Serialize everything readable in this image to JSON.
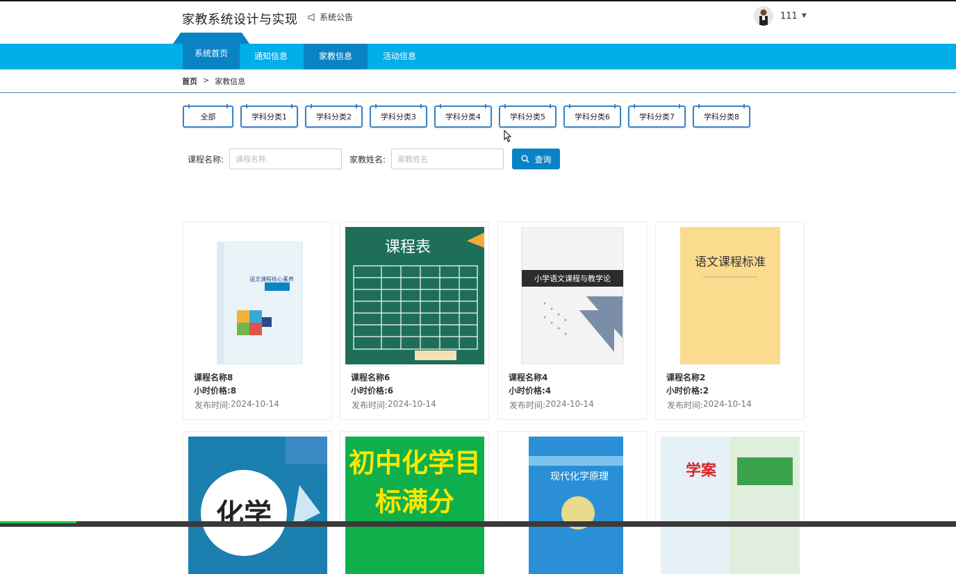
{
  "header": {
    "site_title": "家教系统设计与实现",
    "notice_label": "系统公告",
    "username": "111"
  },
  "nav": {
    "items": [
      "系统首页",
      "通知信息",
      "家教信息",
      "活动信息"
    ],
    "active": "家教信息"
  },
  "breadcrumb": {
    "home": "首页",
    "separator": ">",
    "current": "家教信息"
  },
  "categories": [
    "全部",
    "学科分类1",
    "学科分类2",
    "学科分类3",
    "学科分类4",
    "学科分类5",
    "学科分类6",
    "学科分类7",
    "学科分类8"
  ],
  "search": {
    "course_label": "课程名称:",
    "course_placeholder": "课程名称",
    "teacher_label": "家教姓名:",
    "teacher_placeholder": "家教姓名",
    "button_label": "查询"
  },
  "cards": [
    {
      "title": "课程名称8",
      "price": "小时价格:8",
      "time_label": "发布时间:",
      "time": "2024-10-14",
      "cover": "语文课程核心素养"
    },
    {
      "title": "课程名称6",
      "price": "小时价格:6",
      "time_label": "发布时间:",
      "time": "2024-10-14",
      "cover": "课程表"
    },
    {
      "title": "课程名称4",
      "price": "小时价格:4",
      "time_label": "发布时间:",
      "time": "2024-10-14",
      "cover": "小学语文课程与教学论"
    },
    {
      "title": "课程名称2",
      "price": "小时价格:2",
      "time_label": "发布时间:",
      "time": "2024-10-14",
      "cover": "语文课程标准"
    }
  ],
  "cards_row2": [
    {
      "cover": "化学"
    },
    {
      "cover": "初中化学目标满分"
    },
    {
      "cover": "现代化学原理"
    },
    {
      "cover": "学案"
    }
  ],
  "colors": {
    "nav": "#00aee8",
    "accent": "#0a83c5",
    "border": "#3d83c5"
  }
}
